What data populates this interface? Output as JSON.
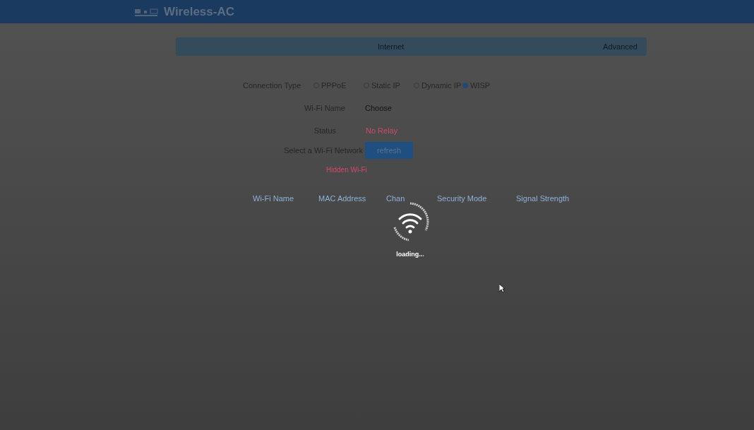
{
  "header": {
    "logo": "Wireless-AC"
  },
  "nav_tabs": [
    "Internet",
    "Advanced"
  ],
  "connection_type": {
    "label": "Connection Type",
    "options": [
      {
        "label": "PPPoE",
        "selected": false
      },
      {
        "label": "Static IP",
        "selected": false
      },
      {
        "label": "Dynamic IP",
        "selected": false
      },
      {
        "label": "WISP",
        "selected": true
      }
    ]
  },
  "wifi_name": {
    "label": "Wi-Fi Name",
    "value": "Choose"
  },
  "status": {
    "label": "Status",
    "value": "No Relay"
  },
  "select_network": {
    "label": "Select a Wi-Fi Network",
    "button": "refresh"
  },
  "hidden_wifi_link": "Hidden Wi-Fi",
  "table": {
    "columns": [
      "Wi-Fi Name",
      "MAC Address",
      "Chan",
      "Security Mode",
      "Signal Strength"
    ]
  },
  "loading": {
    "text": "loading..."
  }
}
